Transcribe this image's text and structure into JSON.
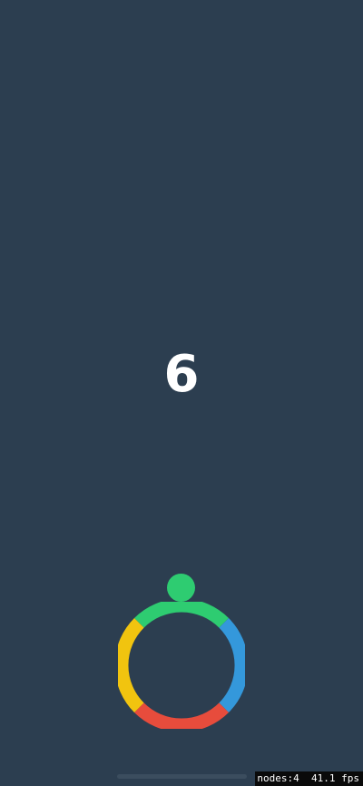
{
  "game": {
    "score": "6",
    "ball_color": "#2ecc71",
    "background_color": "#2c3e50"
  },
  "wheel": {
    "segments": [
      {
        "name": "green",
        "color": "#2ecc71"
      },
      {
        "name": "blue",
        "color": "#3498db"
      },
      {
        "name": "red",
        "color": "#e74c3c"
      },
      {
        "name": "yellow",
        "color": "#f1c40f"
      }
    ]
  },
  "debug": {
    "nodes": "nodes:4",
    "fps": "41.1 fps"
  }
}
